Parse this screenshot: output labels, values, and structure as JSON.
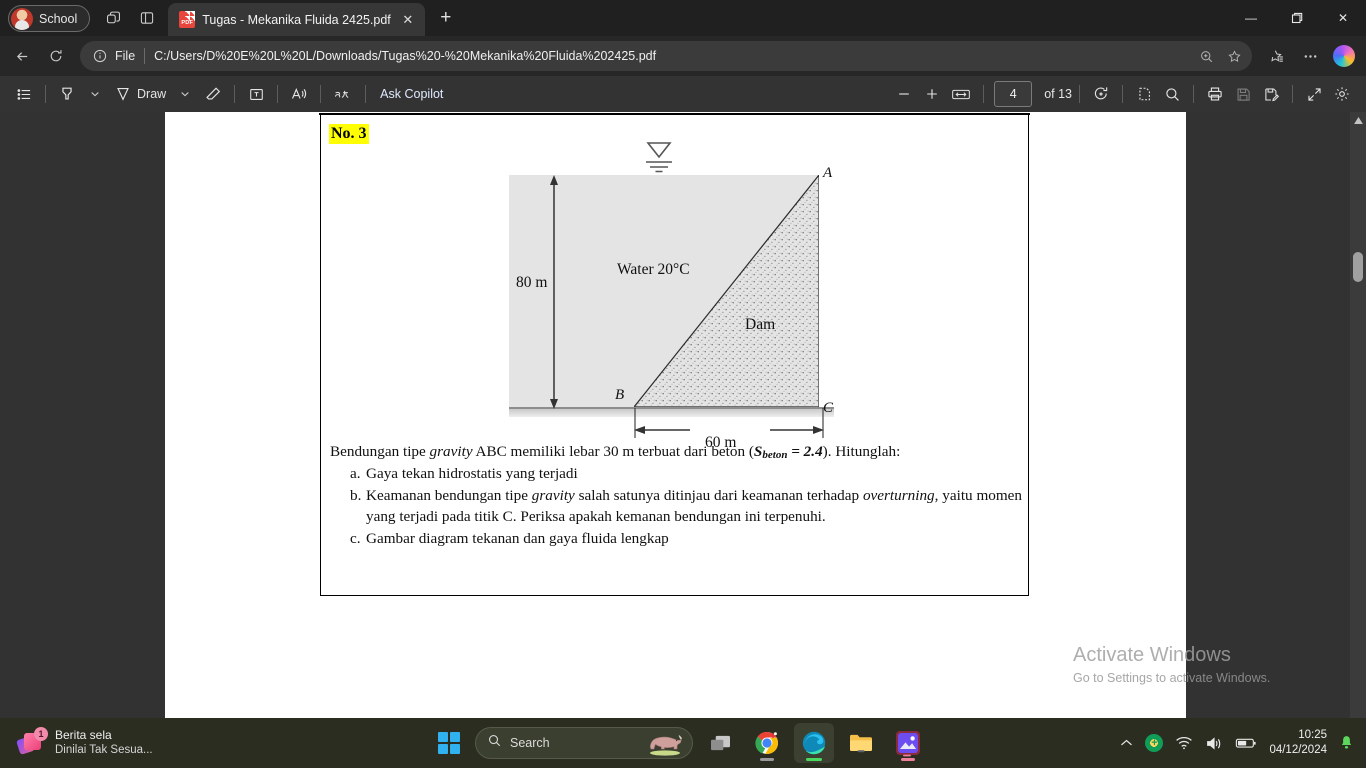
{
  "browser": {
    "profile_label": "School",
    "tab": {
      "title": "Tugas - Mekanika Fluida 2425.pdf",
      "file_icon_label": "PDF",
      "close_label": "✕"
    },
    "newtab_label": "+",
    "window_controls": {
      "minimize": "—",
      "maximize": "❐",
      "close": "✕"
    },
    "address": {
      "scheme_label": "File",
      "url": "C:/Users/D%20E%20L%20L/Downloads/Tugas%20-%20Mekanika%20Fluida%202425.pdf"
    }
  },
  "pdf_toolbar": {
    "draw_label": "Draw",
    "ask_copilot_label": "Ask Copilot",
    "zoom_out_label": "−",
    "zoom_in_label": "+",
    "page_number": "4",
    "of_pages": "of 13",
    "chevron": "⌄"
  },
  "document": {
    "heading": "No. 3",
    "figure": {
      "water_label": "Water 20°C",
      "dam_label": "Dam",
      "height_label": "80 m",
      "width_label": "60 m",
      "point_a": "A",
      "point_b": "B",
      "point_c": "C"
    },
    "intro": {
      "p1": "Bendungan tipe ",
      "i1": "gravity",
      "p2": " ABC memiliki lebar 30 m terbuat dari beton (",
      "sub_s": "S",
      "sub_beton": "beton",
      "p3": " = 2.4",
      "p4": "). Hitunglah:"
    },
    "items": [
      {
        "marker": "a.",
        "text": "Gaya tekan hidrostatis yang terjadi"
      },
      {
        "marker": "b.",
        "text_a": "Keamanan bendungan tipe ",
        "italic_a": "gravity",
        "text_b": " salah satunya ditinjau dari keamanan terhadap ",
        "italic_b": "overturning",
        "text_c": ", yaitu momen yang terjadi pada titik C. Periksa apakah kemanan bendungan ini terpenuhi."
      },
      {
        "marker": "c.",
        "text": "Gambar diagram tekanan dan gaya fluida lengkap"
      }
    ]
  },
  "watermark": {
    "line1": "Activate Windows",
    "line2": "Go to Settings to activate Windows."
  },
  "taskbar": {
    "news": {
      "badge": "1",
      "title": "Berita sela",
      "subtitle": "Dinilai Tak Sesua..."
    },
    "search_placeholder": "Search",
    "clock": {
      "time": "10:25",
      "date": "04/12/2024"
    },
    "tray_chevron": "⌃",
    "bell": "🔔"
  }
}
